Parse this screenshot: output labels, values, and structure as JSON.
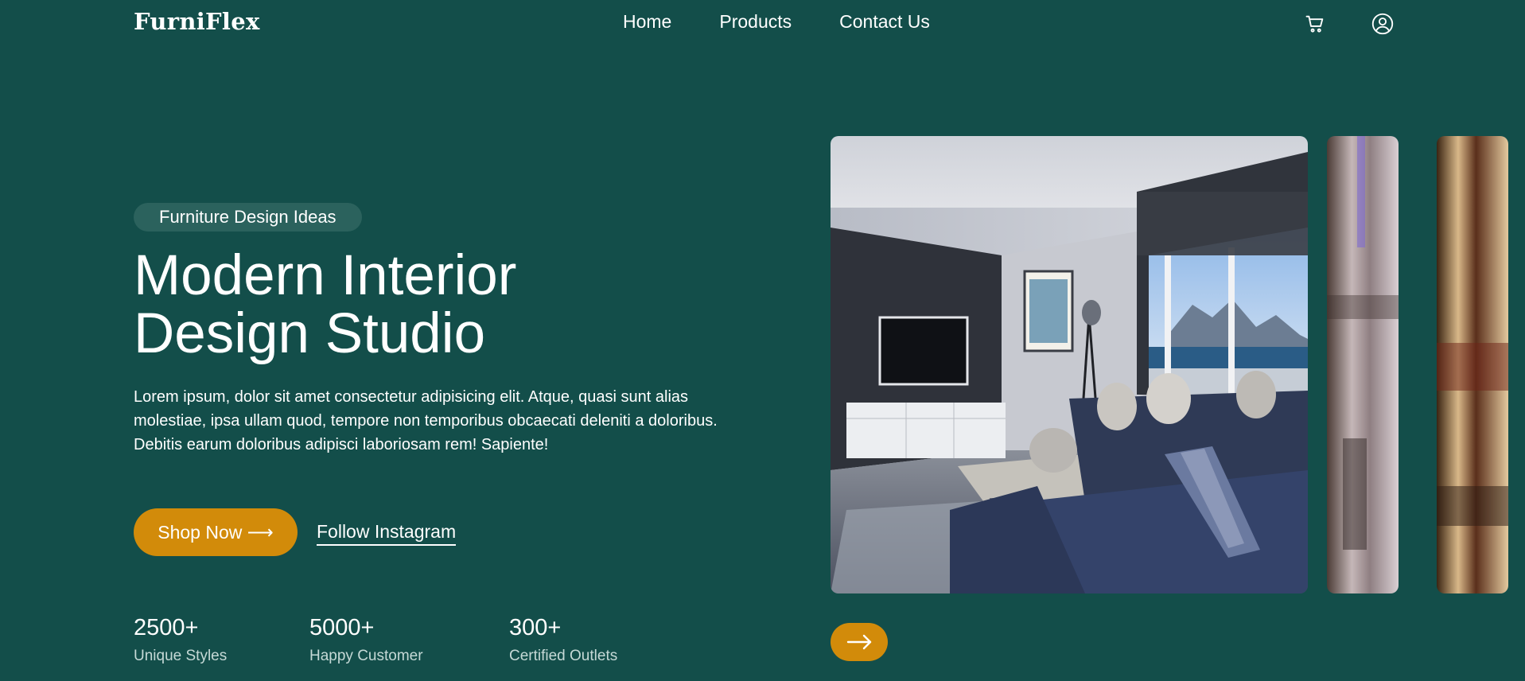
{
  "nav": {
    "logo": "FurniFlex",
    "links": [
      "Home",
      "Products",
      "Contact Us"
    ],
    "icons": [
      "cart-icon",
      "user-icon"
    ]
  },
  "hero": {
    "badge": "Furniture Design Ideas",
    "title_line1": "Modern Interior",
    "title_line2": "Design Studio",
    "description": "Lorem ipsum, dolor sit amet consectetur adipisicing elit. Atque, quasi sunt alias molestiae, ipsa ullam quod, tempore non temporibus obcaecati deleniti a doloribus. Debitis earum doloribus adipisci laboriosam rem! Sapiente!",
    "shop_button": "Shop Now ⟶",
    "instagram_link": "Follow Instagram",
    "stats": [
      {
        "number": "2500+",
        "label": "Unique Styles"
      },
      {
        "number": "5000+",
        "label": "Happy Customer"
      },
      {
        "number": "300+",
        "label": "Certified Outlets"
      }
    ]
  },
  "gallery": {
    "next_icon": "arrow-right-icon"
  },
  "colors": {
    "background": "#134e4a",
    "accent": "#d28b0a",
    "badge": "#2b625d"
  }
}
